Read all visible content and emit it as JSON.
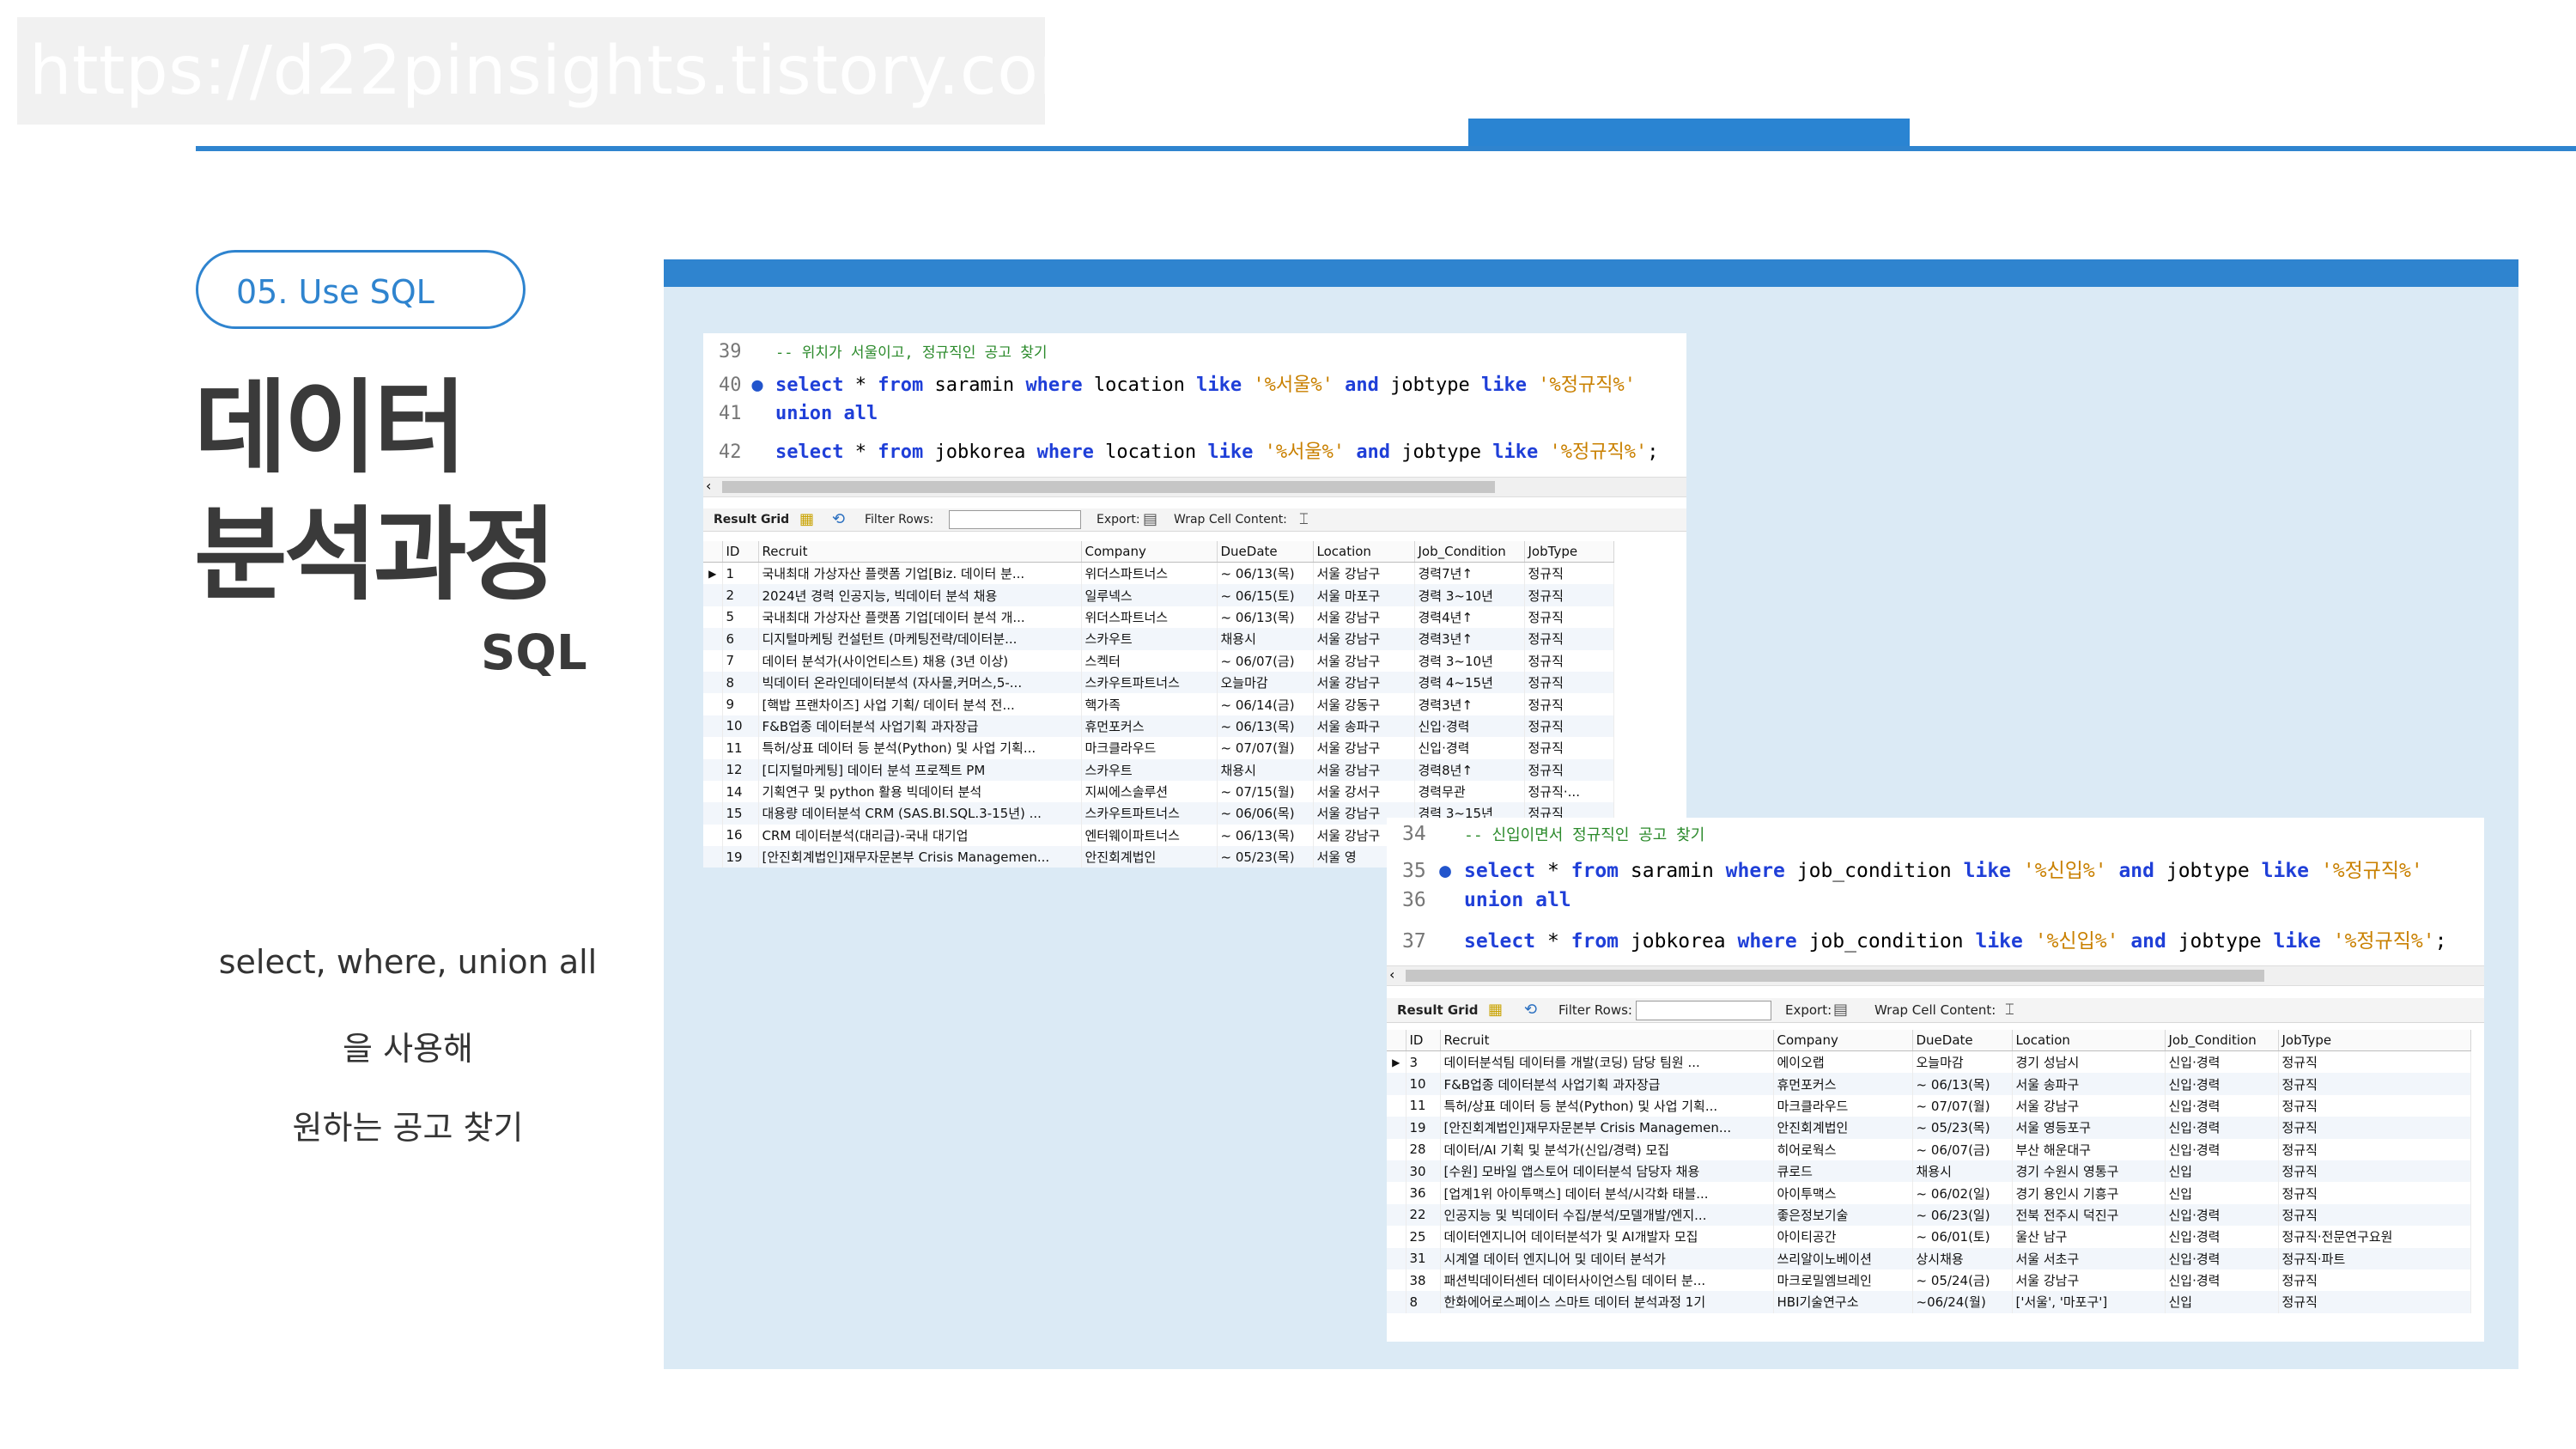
{
  "watermark": "https://d22pinsights.tistory.com",
  "section_pill": "05. Use SQL",
  "title_line1": "데이터",
  "title_line2": "분석과정",
  "subtitle": "SQL",
  "description": [
    "select, where, union all",
    "을 사용해",
    "원하는 공고 찾기"
  ],
  "colors": {
    "accent": "#2f84cf",
    "panel": "#dbeaf5",
    "keyword": "#1f3fd8",
    "string": "#c98000",
    "comment": "#2b8a2b"
  },
  "toolbar": {
    "result_grid": "Result Grid",
    "filter_rows": "Filter Rows:",
    "export": "Export:",
    "wrap": "Wrap Cell Content:",
    "icons": [
      "grid-icon",
      "refresh-icon",
      "export-icon",
      "wrap-icon"
    ]
  },
  "columns": [
    "ID",
    "Recruit",
    "Company",
    "DueDate",
    "Location",
    "Job_Condition",
    "JobType"
  ],
  "query1": {
    "lines": [
      {
        "num": "39",
        "comment": "-- 위치가 서울이고, 정규직인 공고 찾기"
      },
      {
        "num": "40",
        "text": "select * from saramin where location like '%서울%' and jobtype like '%정규직%'"
      },
      {
        "num": "41",
        "text": "union all"
      },
      {
        "num": "42",
        "text": "select * from jobkorea where location like '%서울%' and jobtype like '%정규직%';"
      }
    ],
    "rows": [
      [
        "1",
        "국내최대 가상자산 플랫폼 기업[Biz. 데이터 분...",
        "위더스파트너스",
        "~ 06/13(목)",
        "서울 강남구",
        "경력7년↑",
        "정규직"
      ],
      [
        "2",
        "2024년 경력 인공지능, 빅데이터 분석 채용",
        "일루넥스",
        "~ 06/15(토)",
        "서울 마포구",
        "경력 3~10년",
        "정규직"
      ],
      [
        "5",
        "국내최대 가상자산 플랫폼 기업[데이터 분석 개...",
        "위더스파트너스",
        "~ 06/13(목)",
        "서울 강남구",
        "경력4년↑",
        "정규직"
      ],
      [
        "6",
        "디지털마케팅 컨설턴트 (마케팅전략/데이터분...",
        "스카우트",
        "채용시",
        "서울 강남구",
        "경력3년↑",
        "정규직"
      ],
      [
        "7",
        "데이터 분석가(사이언티스트) 채용 (3년 이상)",
        "스켁터",
        "~ 06/07(금)",
        "서울 강남구",
        "경력 3~10년",
        "정규직"
      ],
      [
        "8",
        "빅데이터 온라인데이터분석 (자사몰,커머스,5-...",
        "스카우트파트너스",
        "오늘마감",
        "서울 강남구",
        "경력 4~15년",
        "정규직"
      ],
      [
        "9",
        "[핵밥 프랜차이즈] 사업 기획/ 데이터 분석 전...",
        "핵가족",
        "~ 06/14(금)",
        "서울 강동구",
        "경력3년↑",
        "정규직"
      ],
      [
        "10",
        "F&B업종 데이터분석 사업기획 과자장급",
        "휴먼포커스",
        "~ 06/13(목)",
        "서울 송파구",
        "신입·경력",
        "정규직"
      ],
      [
        "11",
        "특허/상표 데이터 등 분석(Python) 및 사업 기획...",
        "마크클라우드",
        "~ 07/07(월)",
        "서울 강남구",
        "신입·경력",
        "정규직"
      ],
      [
        "12",
        "[디지털마케팅] 데이터 분석 프로젝트 PM",
        "스카우트",
        "채용시",
        "서울 강남구",
        "경력8년↑",
        "정규직"
      ],
      [
        "14",
        "기획연구 및 python 활용 빅데이터 분석",
        "지씨에스솔루션",
        "~ 07/15(월)",
        "서울 강서구",
        "경력무관",
        "정규직·..."
      ],
      [
        "15",
        "대용량 데이터분석 CRM (SAS.BI.SQL.3-15년) ...",
        "스카우트파트너스",
        "~ 06/06(목)",
        "서울 강남구",
        "경력 3~15년",
        "정규직"
      ],
      [
        "16",
        "CRM 데이터분석(대리급)-국내 대기업",
        "엔터웨이파트너스",
        "~ 06/13(목)",
        "서울 강남구",
        "",
        "정규직"
      ],
      [
        "19",
        "[안진회계법인]재무자문본부 Crisis Managemen...",
        "안진회계법인",
        "~ 05/23(목)",
        "서울 영",
        "",
        ""
      ]
    ]
  },
  "query2": {
    "lines": [
      {
        "num": "34",
        "comment": "-- 신입이면서 정규직인 공고 찾기"
      },
      {
        "num": "35",
        "text": "select * from saramin where job_condition like '%신입%' and jobtype like '%정규직%'"
      },
      {
        "num": "36",
        "text": "union all"
      },
      {
        "num": "37",
        "text": "select * from jobkorea where job_condition like '%신입%' and jobtype like '%정규직%';"
      }
    ],
    "rows": [
      [
        "3",
        "데이터분석팀 데이터를 개발(코딩) 담당 팀원 ...",
        "에이오랩",
        "오늘마감",
        "경기 성남시",
        "신입·경력",
        "정규직"
      ],
      [
        "10",
        "F&B업종 데이터분석 사업기획 과자장급",
        "휴먼포커스",
        "~ 06/13(목)",
        "서울 송파구",
        "신입·경력",
        "정규직"
      ],
      [
        "11",
        "특허/상표 데이터 등 분석(Python) 및 사업 기획...",
        "마크클라우드",
        "~ 07/07(월)",
        "서울 강남구",
        "신입·경력",
        "정규직"
      ],
      [
        "19",
        "[안진회계법인]재무자문본부 Crisis Managemen...",
        "안진회계법인",
        "~ 05/23(목)",
        "서울 영등포구",
        "신입·경력",
        "정규직"
      ],
      [
        "28",
        "데이터/AI 기획 및 분석가(신입/경력) 모집",
        "히어로웍스",
        "~ 06/07(금)",
        "부산 해운대구",
        "신입·경력",
        "정규직"
      ],
      [
        "30",
        "[수원] 모바일 앱스토어 데이터분석 담당자 채용",
        "큐로드",
        "채용시",
        "경기 수원시 영통구",
        "신입",
        "정규직"
      ],
      [
        "36",
        "[업계1위 아이투맥스] 데이터 분석/시각화 태블...",
        "아이투맥스",
        "~ 06/02(일)",
        "경기 용인시 기흥구",
        "신입",
        "정규직"
      ],
      [
        "22",
        "인공지능 및 빅데이터 수집/분석/모델개발/엔지...",
        "좋은정보기술",
        "~ 06/23(일)",
        "전북 전주시 덕진구",
        "신입·경력",
        "정규직"
      ],
      [
        "25",
        "데이터엔지니어 데이터분석가 및 AI개발자 모집",
        "아이티공간",
        "~ 06/01(토)",
        "울산 남구",
        "신입·경력",
        "정규직·전문연구요원"
      ],
      [
        "31",
        "시계열 데이터 엔지니어 및 데이터 분석가",
        "쓰리알이노베이션",
        "상시채용",
        "서울 서초구",
        "신입·경력",
        "정규직·파트"
      ],
      [
        "38",
        "패션빅데이터센터 데이터사이언스팀 데이터 분...",
        "마크로밀엠브레인",
        "~ 05/24(금)",
        "서울 강남구",
        "신입·경력",
        "정규직"
      ],
      [
        "8",
        "한화에어로스페이스 스마트 데이터 분석과정 1기",
        "HBI기술연구소",
        "~06/24(월)",
        "['서울', '마포구']",
        "신입",
        "정규직"
      ]
    ]
  }
}
